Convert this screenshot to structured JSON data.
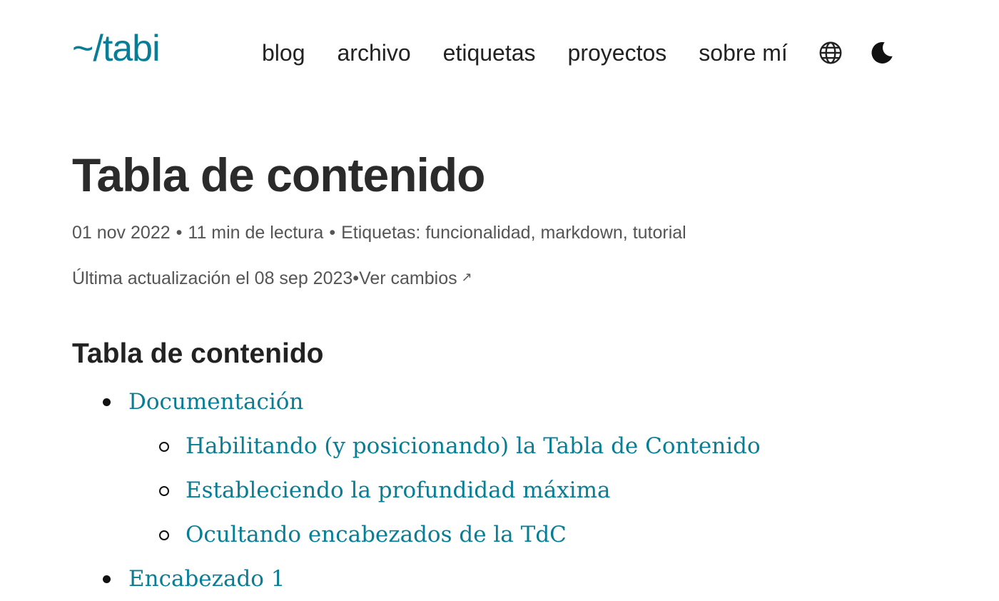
{
  "site": {
    "logo": "~/tabi"
  },
  "nav": {
    "items": [
      {
        "label": "blog"
      },
      {
        "label": "archivo"
      },
      {
        "label": "etiquetas"
      },
      {
        "label": "proyectos"
      },
      {
        "label": "sobre mí"
      }
    ],
    "language_icon": "globe-icon",
    "theme_icon": "moon-icon"
  },
  "post": {
    "title": "Tabla de contenido",
    "date": "01 nov 2022",
    "reading_time": "11 min de lectura",
    "tags_label": "Etiquetas:",
    "tags": [
      "funcionalidad",
      "markdown",
      "tutorial"
    ],
    "updated": "Última actualización el 08 sep 2023",
    "changes_link": "Ver cambios",
    "changes_icon": "external-link-arrow-icon"
  },
  "toc": {
    "heading": "Tabla de contenido",
    "items": [
      {
        "label": "Documentación",
        "children": [
          {
            "label": "Habilitando (y posicionando) la Tabla de Contenido"
          },
          {
            "label": "Estableciendo la profundidad máxima"
          },
          {
            "label": "Ocultando encabezados de la TdC"
          }
        ]
      },
      {
        "label": "Encabezado 1"
      }
    ]
  },
  "colors": {
    "accent": "#087e96",
    "text": "#222222",
    "muted": "#555555"
  }
}
